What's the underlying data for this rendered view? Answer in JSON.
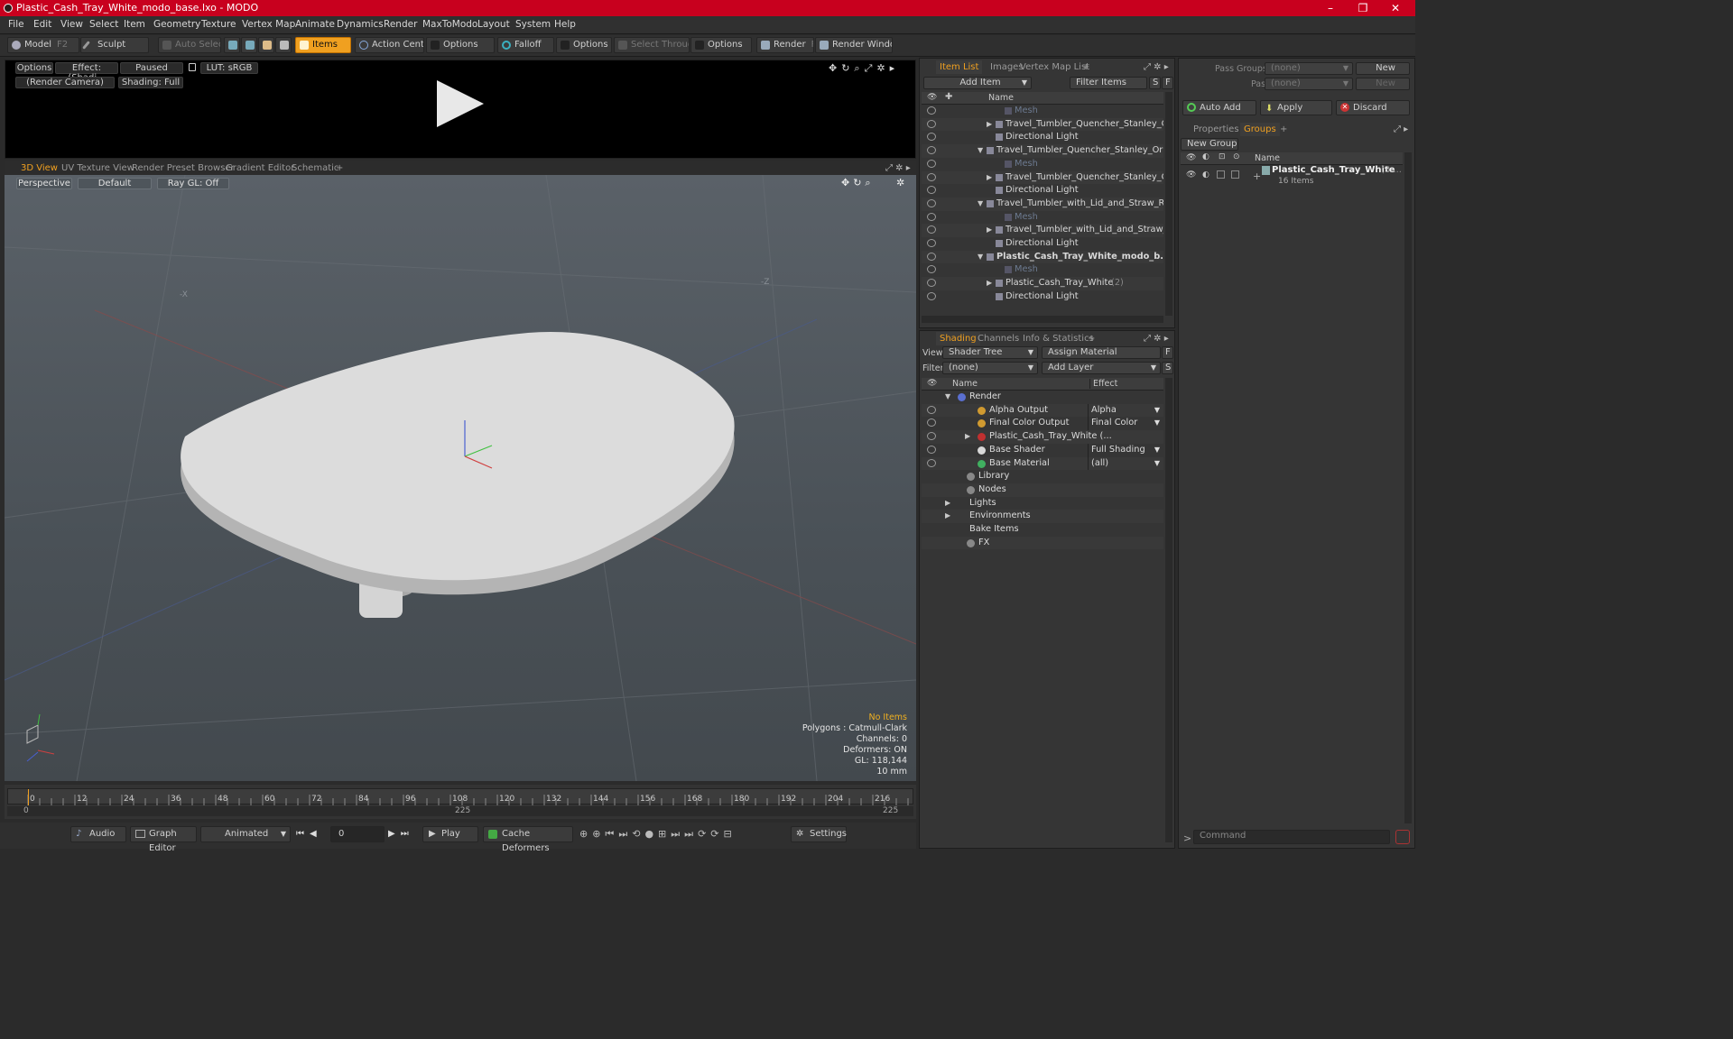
{
  "title": "Plastic_Cash_Tray_White_modo_base.lxo - MODO",
  "window_controls": [
    "–",
    "❐",
    "✕"
  ],
  "menu": [
    "File",
    "Edit",
    "View",
    "Select",
    "Item",
    "Geometry",
    "Texture",
    "Vertex Map",
    "Animate",
    "Dynamics",
    "Render",
    "MaxToModo",
    "Layout",
    "System",
    "Help"
  ],
  "toolbar": {
    "model": "Model",
    "model_key": "F2",
    "sculpt": "Sculpt",
    "auto_select": "Auto Select",
    "items": "Items",
    "action_center": "Action Center",
    "options1": "Options",
    "falloff": "Falloff",
    "options2": "Options",
    "select_through": "Select Through",
    "options3": "Options",
    "render": "Render",
    "render_key": "F9",
    "render_window": "Render Window"
  },
  "render_preview": {
    "options": "Options",
    "effect": "Effect: (Shadi...",
    "paused": "Paused",
    "lut": "LUT: sRGB",
    "camera": "(Render Camera)",
    "shading": "Shading: Full"
  },
  "view_tabs": [
    "3D View",
    "UV Texture View",
    "Render Preset Browser",
    "Gradient Editor",
    "Schematic",
    "+"
  ],
  "viewport": {
    "perspective": "Perspective",
    "default": "Default",
    "raygl": "Ray GL: Off",
    "axis_x": "-X",
    "axis_z": "-Z",
    "info": {
      "no_items": "No Items",
      "polygons": "Polygons : Catmull-Clark",
      "channels": "Channels: 0",
      "deformers": "Deformers: ON",
      "gl": "GL: 118,144",
      "unit": "10 mm"
    }
  },
  "timeline": {
    "ticks": [
      "0",
      "12",
      "24",
      "36",
      "48",
      "60",
      "72",
      "84",
      "96",
      "108",
      "120",
      "132",
      "144",
      "156",
      "168",
      "180",
      "192",
      "204",
      "216"
    ],
    "start": "0",
    "mid": "225",
    "end": "225"
  },
  "transport": {
    "audio": "Audio",
    "graph_editor": "Graph Editor",
    "animated": "Animated",
    "frame": "0",
    "play": "Play",
    "cache": "Cache Deformers",
    "settings": "Settings"
  },
  "item_list": {
    "tabs": [
      "Item List",
      "Images",
      "Vertex Map List",
      "+"
    ],
    "add_item": "Add Item",
    "filter": "Filter Items",
    "s": "S",
    "f": "F",
    "col_name": "Name",
    "rows": [
      {
        "label": "Mesh",
        "indent": 3,
        "dim": true,
        "bold": false,
        "arrow": ""
      },
      {
        "label": "Travel_Tumbler_Quencher_Stanley_Or...",
        "indent": 2,
        "dim": false,
        "bold": false,
        "arrow": "▶"
      },
      {
        "label": "Directional Light",
        "indent": 2,
        "dim": false,
        "bold": false,
        "arrow": ""
      },
      {
        "label": "Travel_Tumbler_Quencher_Stanley_Oran...",
        "indent": 1,
        "dim": false,
        "bold": false,
        "arrow": "▼"
      },
      {
        "label": "Mesh",
        "indent": 3,
        "dim": true,
        "bold": false,
        "arrow": ""
      },
      {
        "label": "Travel_Tumbler_Quencher_Stanley_Or...",
        "indent": 2,
        "dim": false,
        "bold": false,
        "arrow": "▶"
      },
      {
        "label": "Directional Light",
        "indent": 2,
        "dim": false,
        "bold": false,
        "arrow": ""
      },
      {
        "label": "Travel_Tumbler_with_Lid_and_Straw_Re ...",
        "indent": 1,
        "dim": false,
        "bold": false,
        "arrow": "▼"
      },
      {
        "label": "Mesh",
        "indent": 3,
        "dim": true,
        "bold": false,
        "arrow": ""
      },
      {
        "label": "Travel_Tumbler_with_Lid_and_Straw_...",
        "indent": 2,
        "dim": false,
        "bold": false,
        "arrow": "▶"
      },
      {
        "label": "Directional Light",
        "indent": 2,
        "dim": false,
        "bold": false,
        "arrow": ""
      },
      {
        "label": "Plastic_Cash_Tray_White_modo_b...",
        "indent": 1,
        "dim": false,
        "bold": true,
        "arrow": "▼"
      },
      {
        "label": "Mesh",
        "indent": 3,
        "dim": true,
        "bold": false,
        "arrow": ""
      },
      {
        "label": "Plastic_Cash_Tray_White",
        "suffix": "(2)",
        "indent": 2,
        "dim": false,
        "bold": false,
        "arrow": "▶"
      },
      {
        "label": "Directional Light",
        "indent": 2,
        "dim": false,
        "bold": false,
        "arrow": ""
      }
    ]
  },
  "shading": {
    "tabs": [
      "Shading",
      "Channels",
      "Info & Statistics",
      "+"
    ],
    "view_label": "View",
    "view_value": "Shader Tree",
    "assign": "Assign Material",
    "f": "F",
    "filter_label": "Filter",
    "filter_value": "(none)",
    "add_layer": "Add Layer",
    "s": "S",
    "col_name": "Name",
    "col_effect": "Effect",
    "rows": [
      {
        "label": "Render",
        "effect": "",
        "indent": 1,
        "icon": "#5a6fd0",
        "eye": false,
        "arrow": "▼"
      },
      {
        "label": "Alpha Output",
        "effect": "Alpha",
        "indent": 2,
        "icon": "#d09a30",
        "eye": true,
        "arrow": ""
      },
      {
        "label": "Final Color Output",
        "effect": "Final Color",
        "indent": 2,
        "icon": "#d09a30",
        "eye": true,
        "arrow": ""
      },
      {
        "label": "Plastic_Cash_Tray_White (...",
        "effect": "",
        "indent": 2,
        "icon": "#c03030",
        "eye": true,
        "arrow": "▶"
      },
      {
        "label": "Base Shader",
        "effect": "Full Shading",
        "indent": 2,
        "icon": "#d8d8d8",
        "eye": true,
        "arrow": ""
      },
      {
        "label": "Base Material",
        "effect": "(all)",
        "indent": 2,
        "icon": "#40b060",
        "eye": true,
        "arrow": ""
      },
      {
        "label": "Library",
        "effect": "",
        "indent": 1.5,
        "icon": "#888888",
        "eye": false,
        "arrow": ""
      },
      {
        "label": "Nodes",
        "effect": "",
        "indent": 1.5,
        "icon": "#888888",
        "eye": false,
        "arrow": ""
      },
      {
        "label": "Lights",
        "effect": "",
        "indent": 1,
        "icon": "",
        "eye": false,
        "arrow": "▶"
      },
      {
        "label": "Environments",
        "effect": "",
        "indent": 1,
        "icon": "",
        "eye": false,
        "arrow": "▶"
      },
      {
        "label": "Bake Items",
        "effect": "",
        "indent": 1,
        "icon": "",
        "eye": false,
        "arrow": ""
      },
      {
        "label": "FX",
        "effect": "",
        "indent": 1.5,
        "icon": "#888888",
        "eye": false,
        "arrow": ""
      }
    ]
  },
  "right_panel": {
    "pass_groups": "Pass Groups",
    "passes": "Passes",
    "none": "(none)",
    "new": "New",
    "auto_add": "Auto Add",
    "apply": "Apply",
    "discard": "Discard",
    "tabs": [
      "Properties",
      "Groups",
      "+"
    ],
    "new_group": "New Group",
    "col_name": "Name",
    "group_name": "Plastic_Cash_Tray_White",
    "group_suffix": "(3 ...",
    "group_count": "16 Items",
    "command": "Command"
  },
  "colors": {
    "accent": "#f0a020",
    "titlebar": "#c8001e"
  }
}
